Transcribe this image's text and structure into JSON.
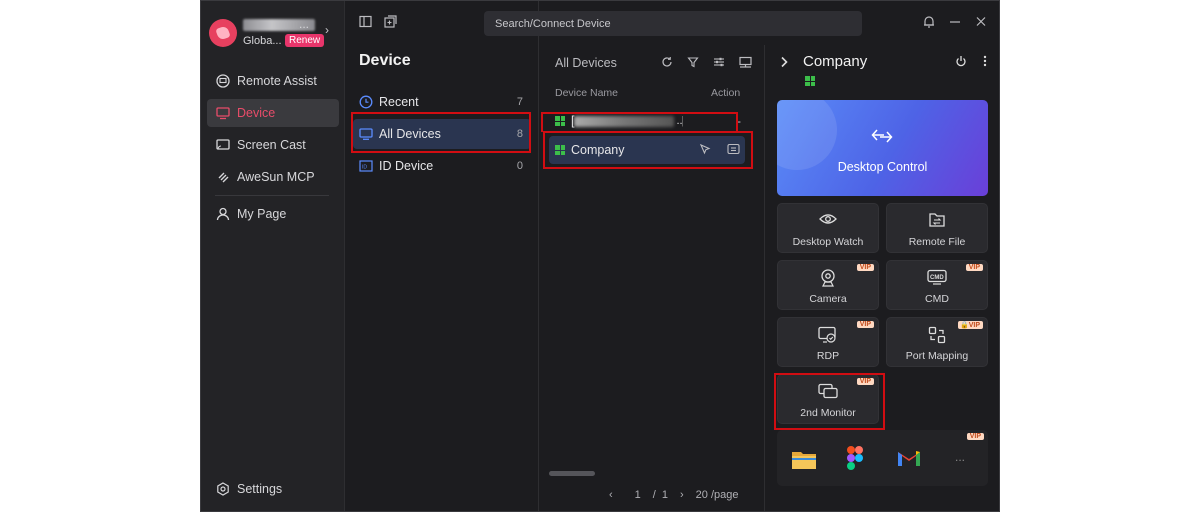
{
  "profile": {
    "region": "Globa...",
    "renew_label": "Renew"
  },
  "nav": {
    "items": [
      {
        "label": "Remote Assist",
        "icon": "remote-assist-icon"
      },
      {
        "label": "Device",
        "icon": "monitor-icon"
      },
      {
        "label": "Screen Cast",
        "icon": "screen-cast-icon"
      },
      {
        "label": "AweSun MCP",
        "icon": "mcp-icon"
      },
      {
        "label": "My Page",
        "icon": "user-icon"
      }
    ],
    "settings_label": "Settings"
  },
  "search": {
    "placeholder": "Search/Connect Device"
  },
  "device_panel": {
    "title": "Device",
    "items": [
      {
        "label": "Recent",
        "count": "7"
      },
      {
        "label": "All Devices",
        "count": "8"
      },
      {
        "label": "ID Device",
        "count": "0"
      }
    ]
  },
  "device_list": {
    "title": "All Devices",
    "col_name": "Device Name",
    "col_action": "Action",
    "rows": [
      {
        "name": "[",
        "action": "-"
      },
      {
        "name": "Company",
        "action": ""
      }
    ],
    "pager": {
      "prev": "‹",
      "page": "1",
      "sep": "/",
      "total": "1",
      "next": "›",
      "per_page": "20 /page"
    }
  },
  "company_panel": {
    "title": "Company",
    "hero_label": "Desktop Control",
    "tiles": [
      {
        "label": "Desktop Watch",
        "vip": ""
      },
      {
        "label": "Remote File",
        "vip": ""
      },
      {
        "label": "Camera",
        "vip": "VIP"
      },
      {
        "label": "CMD",
        "vip": "VIP"
      },
      {
        "label": "RDP",
        "vip": "VIP"
      },
      {
        "label": "Port Mapping",
        "vip": "VIP"
      },
      {
        "label": "2nd Monitor",
        "vip": "VIP"
      }
    ],
    "apps_vip": "VIP",
    "apps_more": "..."
  },
  "colors": {
    "accent": "#e84c6a",
    "highlight": "#d10d12",
    "selected_bg": "#2a3550",
    "windows_green": "#3cbe4a"
  }
}
